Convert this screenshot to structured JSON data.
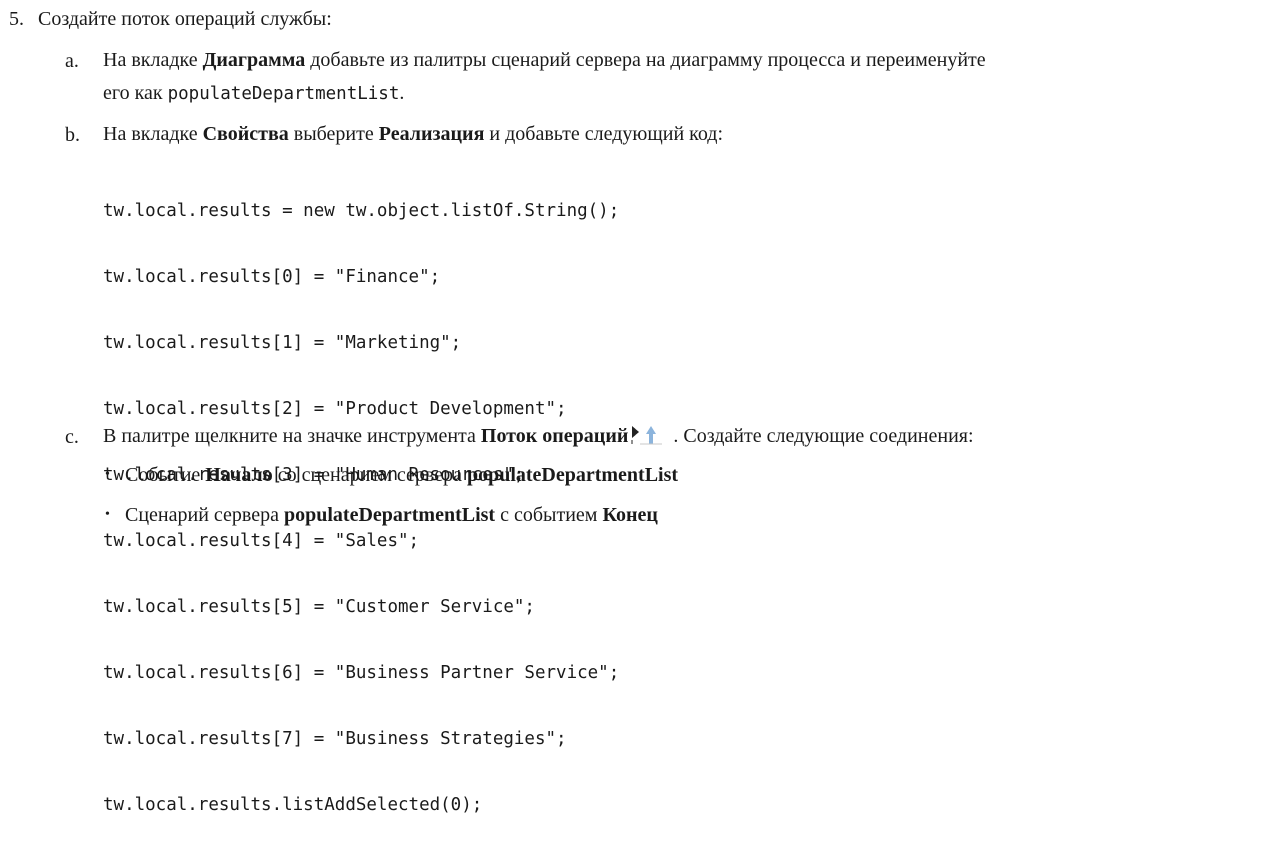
{
  "step": {
    "number": "5.",
    "title": "Создайте поток операций службы:"
  },
  "sub_a": {
    "label": "a.",
    "t1": "На вкладке ",
    "b1": "Диаграмма",
    "t2": " добавьте из палитры сценарий сервера на диаграмму процесса и переименуйте",
    "t3": "его как ",
    "code": "populateDepartmentList",
    "t4": "."
  },
  "sub_b": {
    "label": "b.",
    "t1": "На вкладке ",
    "b1": "Свойства",
    "t2": " выберите ",
    "b2": "Реализация",
    "t3": " и добавьте следующий код:"
  },
  "code_lines": [
    "tw.local.results = new tw.object.listOf.String();",
    "tw.local.results[0] = \"Finance\";",
    "tw.local.results[1] = \"Marketing\";",
    "tw.local.results[2] = \"Product Development\";",
    "tw.local.results[3] = \"Human Resources\";",
    "tw.local.results[4] = \"Sales\";",
    "tw.local.results[5] = \"Customer Service\";",
    "tw.local.results[6] = \"Business Partner Service\";",
    "tw.local.results[7] = \"Business Strategies\";",
    "tw.local.results.listAddSelected(0);"
  ],
  "sub_c": {
    "label": "c.",
    "t1": "В палитре щелкните на значке инструмента ",
    "b1": "Поток операций",
    "icon": "sequence-flow-tool-icon",
    "t2": " . Создайте следующие соединения:"
  },
  "bullets": [
    {
      "symbol": "•",
      "t1": "Событие ",
      "b1": "Начало",
      "t2": " со сценарием сервера ",
      "b2": "populateDepartmentList",
      "t3": ""
    },
    {
      "symbol": "•",
      "t1": "Сценарий сервера ",
      "b1": "populateDepartmentList",
      "t2": " с событием ",
      "b2": "Конец",
      "t3": ""
    }
  ],
  "colors": {
    "text": "#1a1a1a",
    "icon_arrow": "#222222",
    "icon_flow": "#8cb4dc"
  }
}
